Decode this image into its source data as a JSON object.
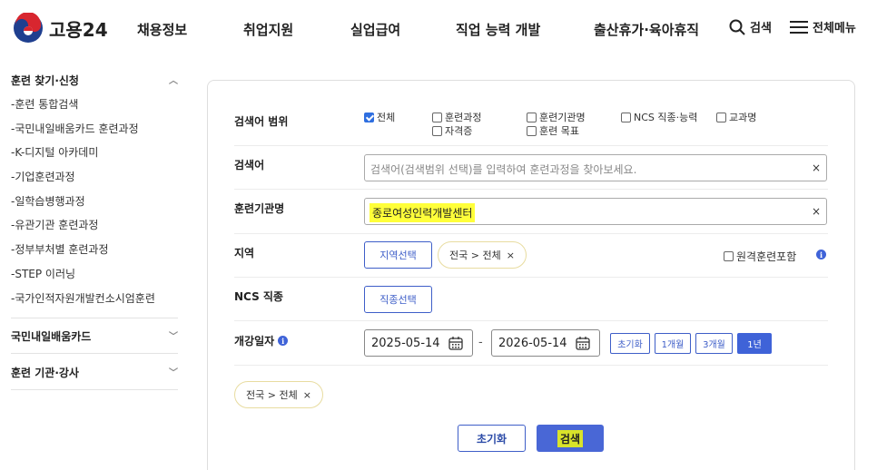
{
  "header": {
    "logo_text": "고용24",
    "nav": [
      "채용정보",
      "취업지원",
      "실업급여",
      "직업 능력 개발",
      "출산휴가·육아휴직"
    ],
    "search_label": "검색",
    "menu_label": "전체메뉴"
  },
  "sidebar": {
    "section1_title": "훈련 찾기·신청",
    "items": [
      "-훈련 통합검색",
      "-국민내일배움카드 훈련과정",
      "-K-디지털 아카데미",
      "-기업훈련과정",
      "-일학습병행과정",
      "-유관기관 훈련과정",
      "-정부부처별 훈련과정",
      "-STEP 이러닝",
      "-국가인적자원개발컨소시엄훈련"
    ],
    "section2_title": "국민내일배움카드",
    "section3_title": "훈련 기관·강사"
  },
  "form": {
    "scope_label": "검색어 범위",
    "scope_options": [
      {
        "label": "전체",
        "checked": true
      },
      {
        "label": "훈련과정",
        "checked": false
      },
      {
        "label": "훈련기관명",
        "checked": false
      },
      {
        "label": "NCS 직종·능력",
        "checked": false
      },
      {
        "label": "교과명",
        "checked": false
      },
      {
        "label": "자격증",
        "checked": false
      },
      {
        "label": "훈련 목표",
        "checked": false
      }
    ],
    "keyword_label": "검색어",
    "keyword_placeholder": "검색어(검색범위 선택)를 입력하여 훈련과정을 찾아보세요.",
    "institution_label": "훈련기관명",
    "institution_value": "종로여성인력개발센터",
    "clear_symbol": "×",
    "region_label": "지역",
    "region_button": "지역선택",
    "region_tag": "전국 > 전체",
    "remote_label": "원격훈련포함",
    "ncs_label": "NCS 직종",
    "ncs_button": "직종선택",
    "date_label": "개강일자",
    "date_start": "2025-05-14",
    "date_sep": "-",
    "date_end": "2026-05-14",
    "period_buttons": [
      "초기화",
      "1개월",
      "3개월",
      "1년"
    ],
    "period_active": "1년",
    "summary_tag": "전국 > 전체",
    "reset_button": "초기화",
    "search_button": "검색"
  },
  "colors": {
    "accent": "#3f63d8",
    "highlight": "#ffff3a"
  }
}
